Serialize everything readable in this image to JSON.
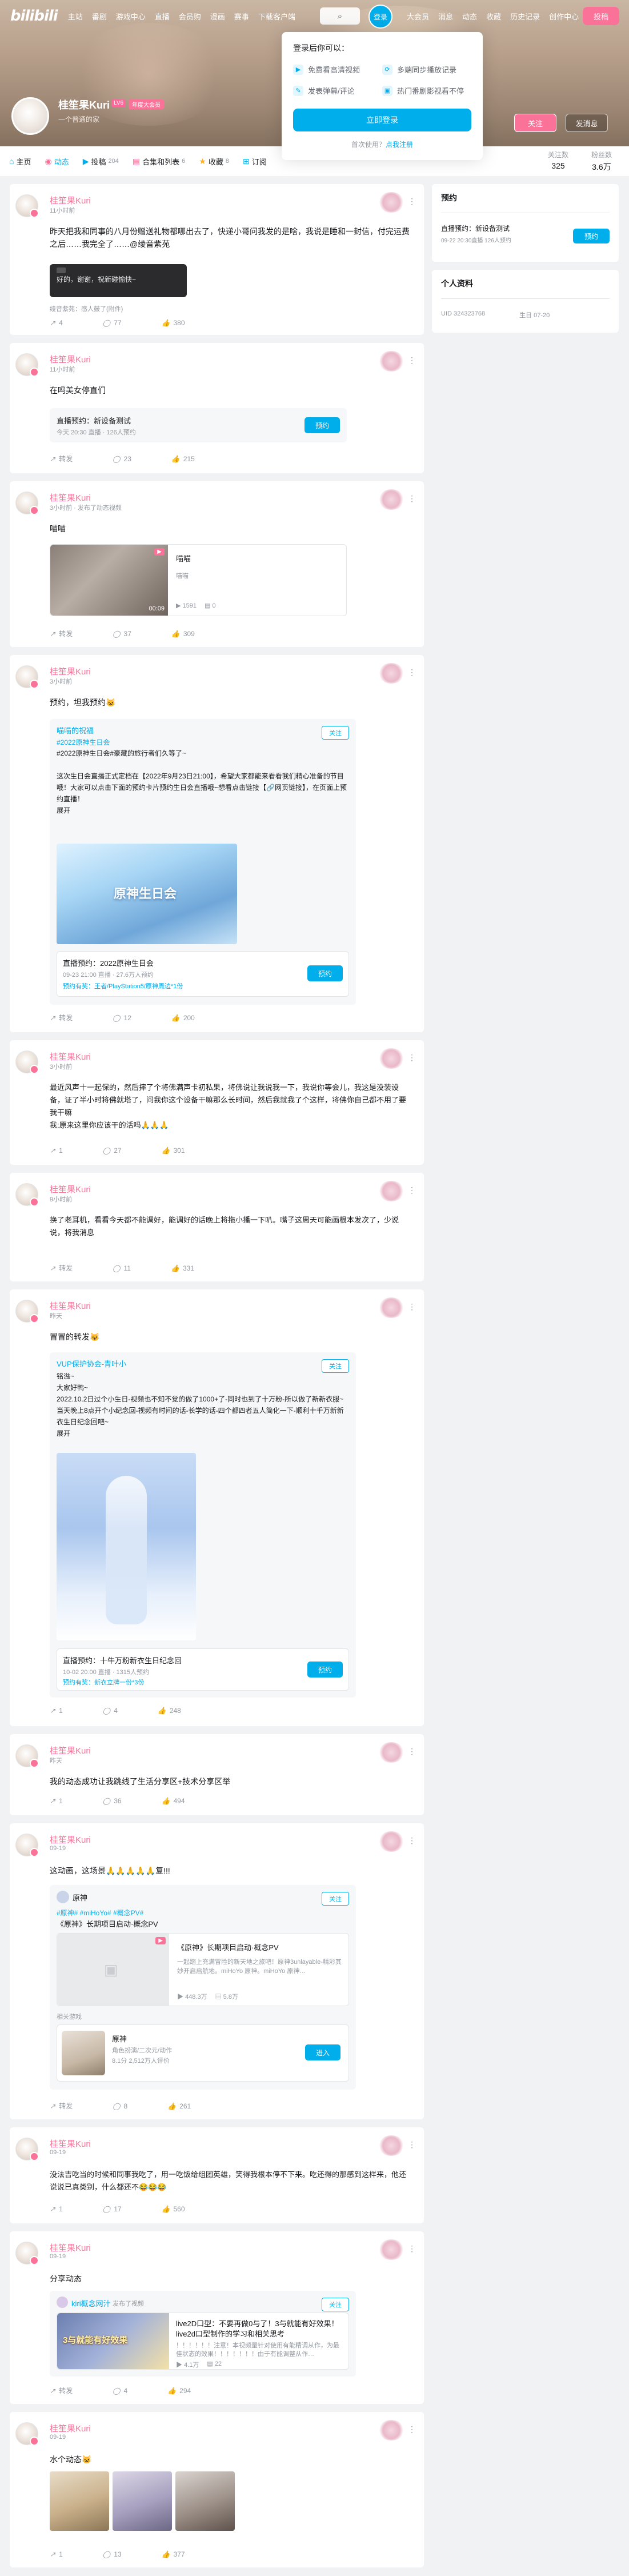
{
  "header": {
    "logo": "bilibili",
    "nav": [
      "主站",
      "番剧",
      "游戏中心",
      "直播",
      "会员购",
      "漫画",
      "赛事",
      "下载客户端"
    ],
    "search_icon": "search-icon",
    "login": "登录",
    "right": [
      "大会员",
      "消息",
      "动态",
      "收藏",
      "历史记录",
      "创作中心"
    ],
    "upload": "投稿"
  },
  "login_popup": {
    "title": "登录后你可以：",
    "perks": [
      "免费看高清视频",
      "多端同步播放记录",
      "发表弹幕/评论",
      "热门番剧影视看不停"
    ],
    "button": "立即登录",
    "register_prefix": "首次使用？",
    "register_link": "点我注册"
  },
  "profile": {
    "name": "桂笙果Kuri",
    "level": "LV6",
    "vip": "年度大会员",
    "sign": "一个普通的家",
    "follow": "关注",
    "message": "发消息"
  },
  "tabs": [
    {
      "label": "主页",
      "count": ""
    },
    {
      "label": "动态",
      "count": ""
    },
    {
      "label": "投稿",
      "count": "204"
    },
    {
      "label": "合集和列表",
      "count": "6"
    },
    {
      "label": "收藏",
      "count": "8"
    },
    {
      "label": "订阅",
      "count": ""
    }
  ],
  "stats": [
    {
      "label": "关注数",
      "value": "325"
    },
    {
      "label": "粉丝数",
      "value": "3.6万"
    }
  ],
  "side": {
    "reserve": {
      "title": "预约",
      "item": "直播预约：新设备测试",
      "sub": "09-22 20:30直播 126人预约",
      "button": "预约"
    },
    "info": {
      "title": "个人资料",
      "uid": "UID 324323768",
      "birth": "生日 07-20"
    }
  },
  "posts": [
    {
      "name": "桂笙果Kuri",
      "time": "11小时前",
      "text": "昨天把我和同事的八月份赠送礼物都哪出去了，快递小哥问我发的是啥，我说是睡和一封信，付完运费之后……我完全了……@绫音紫苑",
      "comment_user": "绫音紫苑：",
      "comment_text": "好的，谢谢，祝新碰愉快~",
      "comment_time": "感人鼓了(附件)",
      "share": "4",
      "comments": "77",
      "likes": "380"
    },
    {
      "name": "桂笙果Kuri",
      "time": "11小时前",
      "text": "在吗美女停直们",
      "card_title": "直播预约：新设备测试",
      "card_sub": "今天 20:30 直播 · 126人预约",
      "btn": "预约",
      "share": "转发",
      "comments": "23",
      "likes": "215"
    },
    {
      "name": "桂笙果Kuri",
      "time": "3小时前 · 发布了动态视频",
      "text": "喵喵",
      "video_title": "喵喵",
      "video_sub": "喵喵",
      "dur": "00:09",
      "views": "1591",
      "danmu": "0",
      "share": "转发",
      "comments": "37",
      "likes": "309"
    },
    {
      "name": "桂笙果Kuri",
      "time": "3小时前",
      "text": "预约，坦我预约😺",
      "fwd_user": "喵喵的祝福",
      "fwd_tag": "#2022原神生日会",
      "fwd_text": "#2022原神生日会#豪藏的旅行者们久等了~\n\n这次生日会直播正式定档在【2022年9月23日21:00】，希望大家都能来看看我们精心准备的节目哦！大家可以点击下面的预约卡片预约生日会直播哦~想看点击链接【🔗网页链接】，在页面上预约直播！\n展开",
      "img_text": "原神生日会",
      "card_title": "直播预约：2022原神生日会",
      "card_sub": "09-23 21:00 直播 · 27.6万人预约",
      "card_link": "预约有奖：王者/PlayStation5/原神周边*1份",
      "btn": "预约",
      "share": "转发",
      "comments": "12",
      "likes": "200"
    },
    {
      "name": "桂笙果Kuri",
      "time": "3小时前",
      "text": "最近风声十一起保的，然后摔了个将佛满声卡初私果，将佛说让我说我一下，我说你等会儿，我这是没装设备，证了半小时将佛就塔了，问我你这个设备干嘛那么长时间，然后我就我了个这样，将佛你自己都不用了要我干嘛\n我:原来这里你应该干的活吗🙏🙏🙏",
      "share": "1",
      "comments": "27",
      "likes": "301"
    },
    {
      "name": "桂笙果Kuri",
      "time": "9小时前",
      "text": "换了老耳机，看看今天都不能调好，能调好的话晚上将拖小播一下叭。嘴子这周天可能画根本发次了，少说说，将我消息",
      "share": "转发",
      "comments": "11",
      "likes": "331"
    },
    {
      "name": "桂笙果Kuri",
      "time": "昨天",
      "text": "冒冒的转发😺",
      "fwd_user": "VUP保护协会-青叶小",
      "fwd_text": "铭溢~\n大家好鸭~\n2022.10.2日过个小生日-视频也不知不觉的做了1000+了-同时也到了十万粉-所以做了新新衣服~当天晚上8点开个小纪念回-视频有时间的话-长学的话-四个都四者五人简化一下-顺利十千万新新衣生日纪念回吧~\n展开",
      "card_title": "直播预约：十牛万粉新衣生日纪念回",
      "card_sub": "10-02 20:00 直播 · 1315人预约",
      "card_link": "预约有奖：新衣立牌一份*3份",
      "btn": "预约",
      "share": "1",
      "comments": "4",
      "likes": "248"
    },
    {
      "name": "桂笙果Kuri",
      "time": "昨天",
      "text": "我的动态成功让我跳线了生活分享区+技术分享区举",
      "share": "1",
      "comments": "36",
      "likes": "494"
    },
    {
      "name": "桂笙果Kuri",
      "time": "09-19",
      "text": "这动画，这场景🙏🙏🙏🙏🙏复!!!",
      "fwd_user": "原神",
      "fwd_tag": "#原神# #miHoYo# #概念PV#",
      "fwd_text": "《原神》长期项目启动·概念PV",
      "video_title": "《原神》长期项目启动·概念PV",
      "video_desc": "一起踏上充满冒险的新天地之旅吧！原神3unlayable-精彩其妙开启启航地。miHoYo 原神。miHoYo 原神…",
      "views": "448.3万",
      "danmu": "5.8万",
      "related_label": "相关游戏",
      "game_name": "原神",
      "game_sub": "角色扮演/二次元/动作",
      "game_meta": "8.1分 2,512万人评价",
      "game_btn": "进入",
      "share": "转发",
      "comments": "8",
      "likes": "261"
    },
    {
      "name": "桂笙果Kuri",
      "time": "09-19",
      "text": "没法吉吃当的时候和同事我吃了，用一吃饭给组团英雄，笑得我根本停不下来。吃还得的那感到这样来，他还说说已真类别，什么都还不😂😂😂",
      "share": "1",
      "comments": "17",
      "likes": "560"
    },
    {
      "name": "桂笙果Kuri",
      "time": "09-19",
      "text": "分享动态",
      "fwd_user": "kiri概念网汁",
      "fwd_time": "发布了视频",
      "video_title": "live2D口型：不要再做0与了！3与就能有好效果！live2d口型制作的学习和相关思考",
      "video_desc": "！！！！！！注意！本视频量针对使用有能精调从作，为最佳状态的效果！！！！！！！由于有能调整从作…",
      "cover_text": "3与就能有好效果",
      "views": "4.1万",
      "danmu": "22",
      "share": "转发",
      "comments": "4",
      "likes": "294"
    },
    {
      "name": "桂笙果Kuri",
      "time": "09-19",
      "text": "水个动态😺",
      "share": "1",
      "comments": "13",
      "likes": "377"
    }
  ]
}
